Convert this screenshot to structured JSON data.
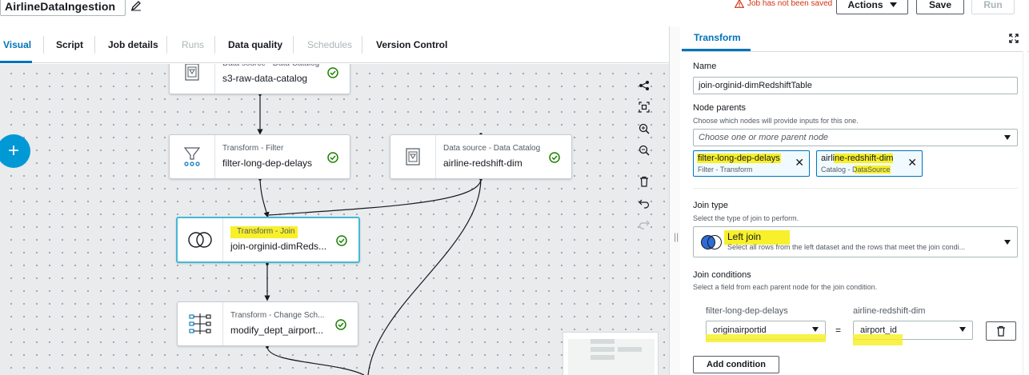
{
  "header": {
    "job_name": "AirlineDataIngestion",
    "warning": "Job has not been saved",
    "actions_label": "Actions",
    "save_label": "Save",
    "run_label": "Run"
  },
  "tabs": [
    {
      "label": "Visual",
      "state": "active"
    },
    {
      "label": "Script",
      "state": "enabled"
    },
    {
      "label": "Job details",
      "state": "enabled"
    },
    {
      "label": "Runs",
      "state": "disabled"
    },
    {
      "label": "Data quality",
      "state": "enabled"
    },
    {
      "label": "Schedules",
      "state": "disabled"
    },
    {
      "label": "Version Control",
      "state": "enabled"
    }
  ],
  "canvas": {
    "add_label": "+",
    "nodes": [
      {
        "type": "Data source - Data Catalog",
        "name": "s3-raw-data-catalog"
      },
      {
        "type": "Transform - Filter",
        "name": "filter-long-dep-delays"
      },
      {
        "type": "Data source - Data Catalog",
        "name": "airline-redshift-dim"
      },
      {
        "type": "Transform - Join",
        "name": "join-orginid-dimReds..."
      },
      {
        "type": "Transform - Change Sch...",
        "name": "modify_dept_airport..."
      }
    ]
  },
  "panel": {
    "tab_label": "Transform",
    "name_label": "Name",
    "name_value": "join-orginid-dimRedshiftTable",
    "parents_label": "Node parents",
    "parents_desc": "Choose which nodes will provide inputs for this one.",
    "parents_placeholder": "Choose one or more parent node",
    "parents": [
      {
        "name": "filter-long-dep-delays",
        "kind": "Filter - Transform"
      },
      {
        "name": "airline-redshift-dim",
        "kind": "Catalog - DataSource"
      }
    ],
    "join_type_label": "Join type",
    "join_type_desc": "Select the type of join to perform.",
    "join_type_value": "Left join",
    "join_type_value_desc": "Select all rows from the left dataset and the rows that meet the join condi...",
    "join_cond_label": "Join conditions",
    "join_cond_desc": "Select a field from each parent node for the join condition.",
    "left_header": "filter-long-dep-delays",
    "right_header": "airline-redshift-dim",
    "equals": "=",
    "left_field": "originairportid",
    "right_field": "airport_id",
    "add_condition_label": "Add condition"
  },
  "colors": {
    "accent": "#0073bb",
    "highlight": "#f7f02a",
    "success": "#1d8102",
    "warning": "#d13212"
  }
}
